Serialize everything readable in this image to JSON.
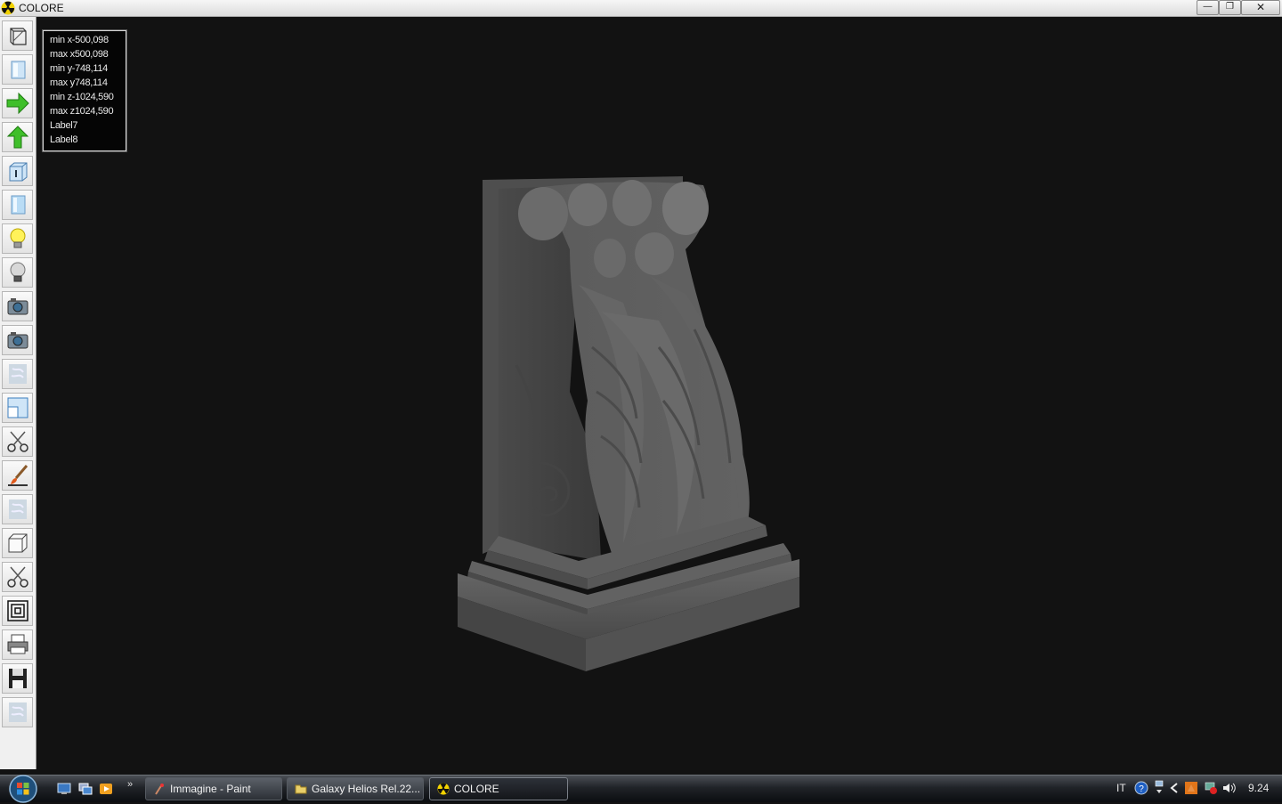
{
  "window": {
    "title": "COLORE",
    "buttons": {
      "minimize": "—",
      "restore": "❐",
      "close": "✕"
    }
  },
  "toolbar": {
    "tools": [
      "wireframe-box-icon",
      "cube-light-icon",
      "arrow-right-icon",
      "arrow-up-icon",
      "box-info-icon",
      "cube-blue-icon",
      "lightbulb-on-icon",
      "lightbulb-off-icon",
      "camera-icon",
      "camera-icon",
      "frosted-tile-icon",
      "view-split-icon",
      "scissors-icon",
      "brush-icon",
      "frosted-tile-icon",
      "white-cube-icon",
      "scissors-icon",
      "nested-squares-icon",
      "printer-icon",
      "floppy-disk-icon",
      "frosted-tile-icon"
    ]
  },
  "info": {
    "lines": [
      "min x-500,098",
      "max x500,098",
      "min y-748,114",
      "max y748,114",
      "min z-1024,590",
      "max z1024,590",
      "Label7",
      "Label8"
    ]
  },
  "colors": {
    "viewport_bg": "#121212",
    "model_gray": "#5a5a5a",
    "arrow_green": "#3fbf2a"
  },
  "taskbar": {
    "quick_launch_more": "»",
    "tasks": [
      {
        "label": "Immagine - Paint",
        "icon": "paint-icon",
        "active": false
      },
      {
        "label": "Galaxy Helios  Rel.22...",
        "icon": "folder-icon",
        "active": false
      },
      {
        "label": "COLORE",
        "icon": "radiation-icon",
        "active": true
      }
    ],
    "tray": {
      "language": "IT",
      "clock": "9.24"
    }
  }
}
